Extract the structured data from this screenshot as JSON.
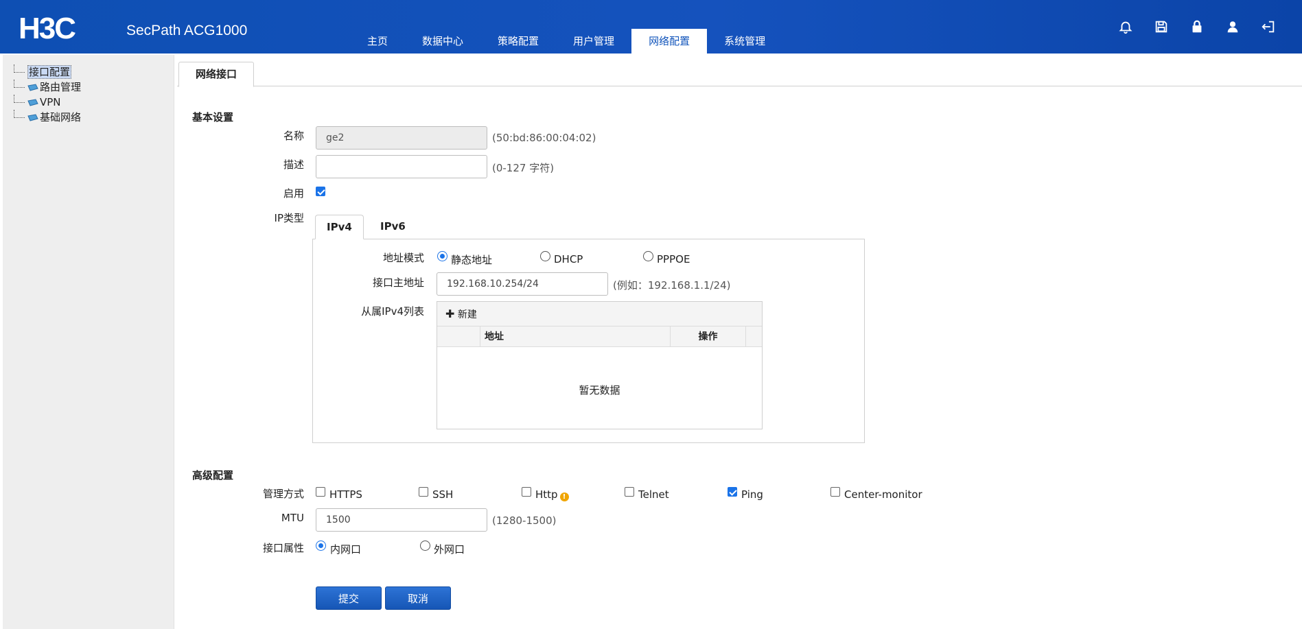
{
  "header": {
    "logo_text": "H3C",
    "product": "SecPath ACG1000",
    "nav": [
      "主页",
      "数据中心",
      "策略配置",
      "用户管理",
      "网络配置",
      "系统管理"
    ],
    "nav_active": "网络配置",
    "icons": [
      "bell-icon",
      "save-icon",
      "lock-icon",
      "user-icon",
      "logout-icon"
    ]
  },
  "sidebar": {
    "items": [
      {
        "label": "接口配置",
        "selected": true
      },
      {
        "label": "路由管理"
      },
      {
        "label": "VPN"
      },
      {
        "label": "基础网络"
      }
    ]
  },
  "main": {
    "tab": "网络接口",
    "basic": {
      "title": "基本设置",
      "name_label": "名称",
      "name_value": "ge2",
      "mac_hint": "(50:bd:86:00:04:02)",
      "desc_label": "描述",
      "desc_value": "",
      "desc_hint": "(0-127 字符)",
      "enable_label": "启用",
      "enable_checked": true,
      "iptype_label": "IP类型",
      "ip_tabs": [
        "IPv4",
        "IPv6"
      ],
      "addr_mode_label": "地址模式",
      "addr_modes": [
        "静态地址",
        "DHCP",
        "PPPOE"
      ],
      "addr_mode_selected": "静态地址",
      "primary_label": "接口主地址",
      "primary_value": "192.168.10.254/24",
      "primary_hint": "(例如：192.168.1.1/24)",
      "secondary_label": "从属IPv4列表",
      "table": {
        "add_label": "新建",
        "columns": [
          "",
          "地址",
          "操作"
        ],
        "empty": "暂无数据"
      }
    },
    "advanced": {
      "title": "高级配置",
      "mgmt_label": "管理方式",
      "mgmt_options": [
        {
          "label": "HTTPS",
          "checked": false
        },
        {
          "label": "SSH",
          "checked": false
        },
        {
          "label": "Http",
          "checked": false,
          "warn": true
        },
        {
          "label": "Telnet",
          "checked": false
        },
        {
          "label": "Ping",
          "checked": true
        },
        {
          "label": "Center-monitor",
          "checked": false
        }
      ],
      "mtu_label": "MTU",
      "mtu_value": "1500",
      "mtu_hint": "(1280-1500)",
      "attr_label": "接口属性",
      "attr_options": [
        "内网口",
        "外网口"
      ],
      "attr_selected": "内网口"
    },
    "submit_label": "提交",
    "cancel_label": "取消"
  },
  "colors": {
    "header": "#1552bd",
    "accent": "#1a73e8",
    "button": "#1c5fc4"
  }
}
